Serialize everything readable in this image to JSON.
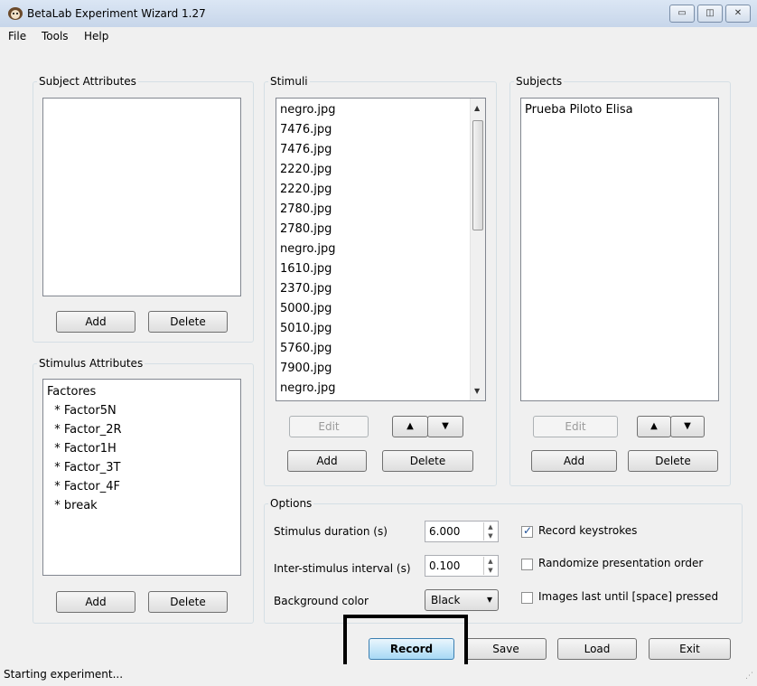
{
  "window": {
    "title": "BetaLab Experiment Wizard 1.27"
  },
  "menu": [
    "File",
    "Tools",
    "Help"
  ],
  "subject_attributes": {
    "legend": "Subject Attributes",
    "items": [],
    "add_label": "Add",
    "delete_label": "Delete"
  },
  "stimulus_attributes": {
    "legend": "Stimulus Attributes",
    "items": [
      "Factores",
      "  * Factor5N",
      "  * Factor_2R",
      "  * Factor1H",
      "  * Factor_3T",
      "  * Factor_4F",
      "  * break"
    ],
    "add_label": "Add",
    "delete_label": "Delete"
  },
  "stimuli": {
    "legend": "Stimuli",
    "items": [
      "negro.jpg",
      "7476.jpg",
      "7476.jpg",
      "2220.jpg",
      "2220.jpg",
      "2780.jpg",
      "2780.jpg",
      "negro.jpg",
      "1610.jpg",
      "2370.jpg",
      "5000.jpg",
      "5010.jpg",
      "5760.jpg",
      "7900.jpg",
      "negro.jpg"
    ],
    "edit_label": "Edit",
    "add_label": "Add",
    "delete_label": "Delete"
  },
  "subjects": {
    "legend": "Subjects",
    "items": [
      "Prueba Piloto Elisa"
    ],
    "edit_label": "Edit",
    "add_label": "Add",
    "delete_label": "Delete"
  },
  "options": {
    "legend": "Options",
    "stimulus_duration_label": "Stimulus duration (s)",
    "stimulus_duration_value": "6.000",
    "isi_label": "Inter-stimulus interval (s)",
    "isi_value": "0.100",
    "bg_label": "Background color",
    "bg_value": "Black",
    "record_keystrokes_label": "Record keystrokes",
    "record_keystrokes_checked": true,
    "randomize_label": "Randomize presentation order",
    "randomize_checked": false,
    "images_last_label": "Images last until [space] pressed",
    "images_last_checked": false
  },
  "actions": {
    "record": "Record",
    "save": "Save",
    "load": "Load",
    "exit": "Exit"
  },
  "status": "Starting experiment...",
  "icons": {
    "up": "▲",
    "down": "▼",
    "check": "✓",
    "dropdown": "▾"
  },
  "colors": {
    "accent": "#3c7fb1",
    "highlight_box": "#000000"
  }
}
